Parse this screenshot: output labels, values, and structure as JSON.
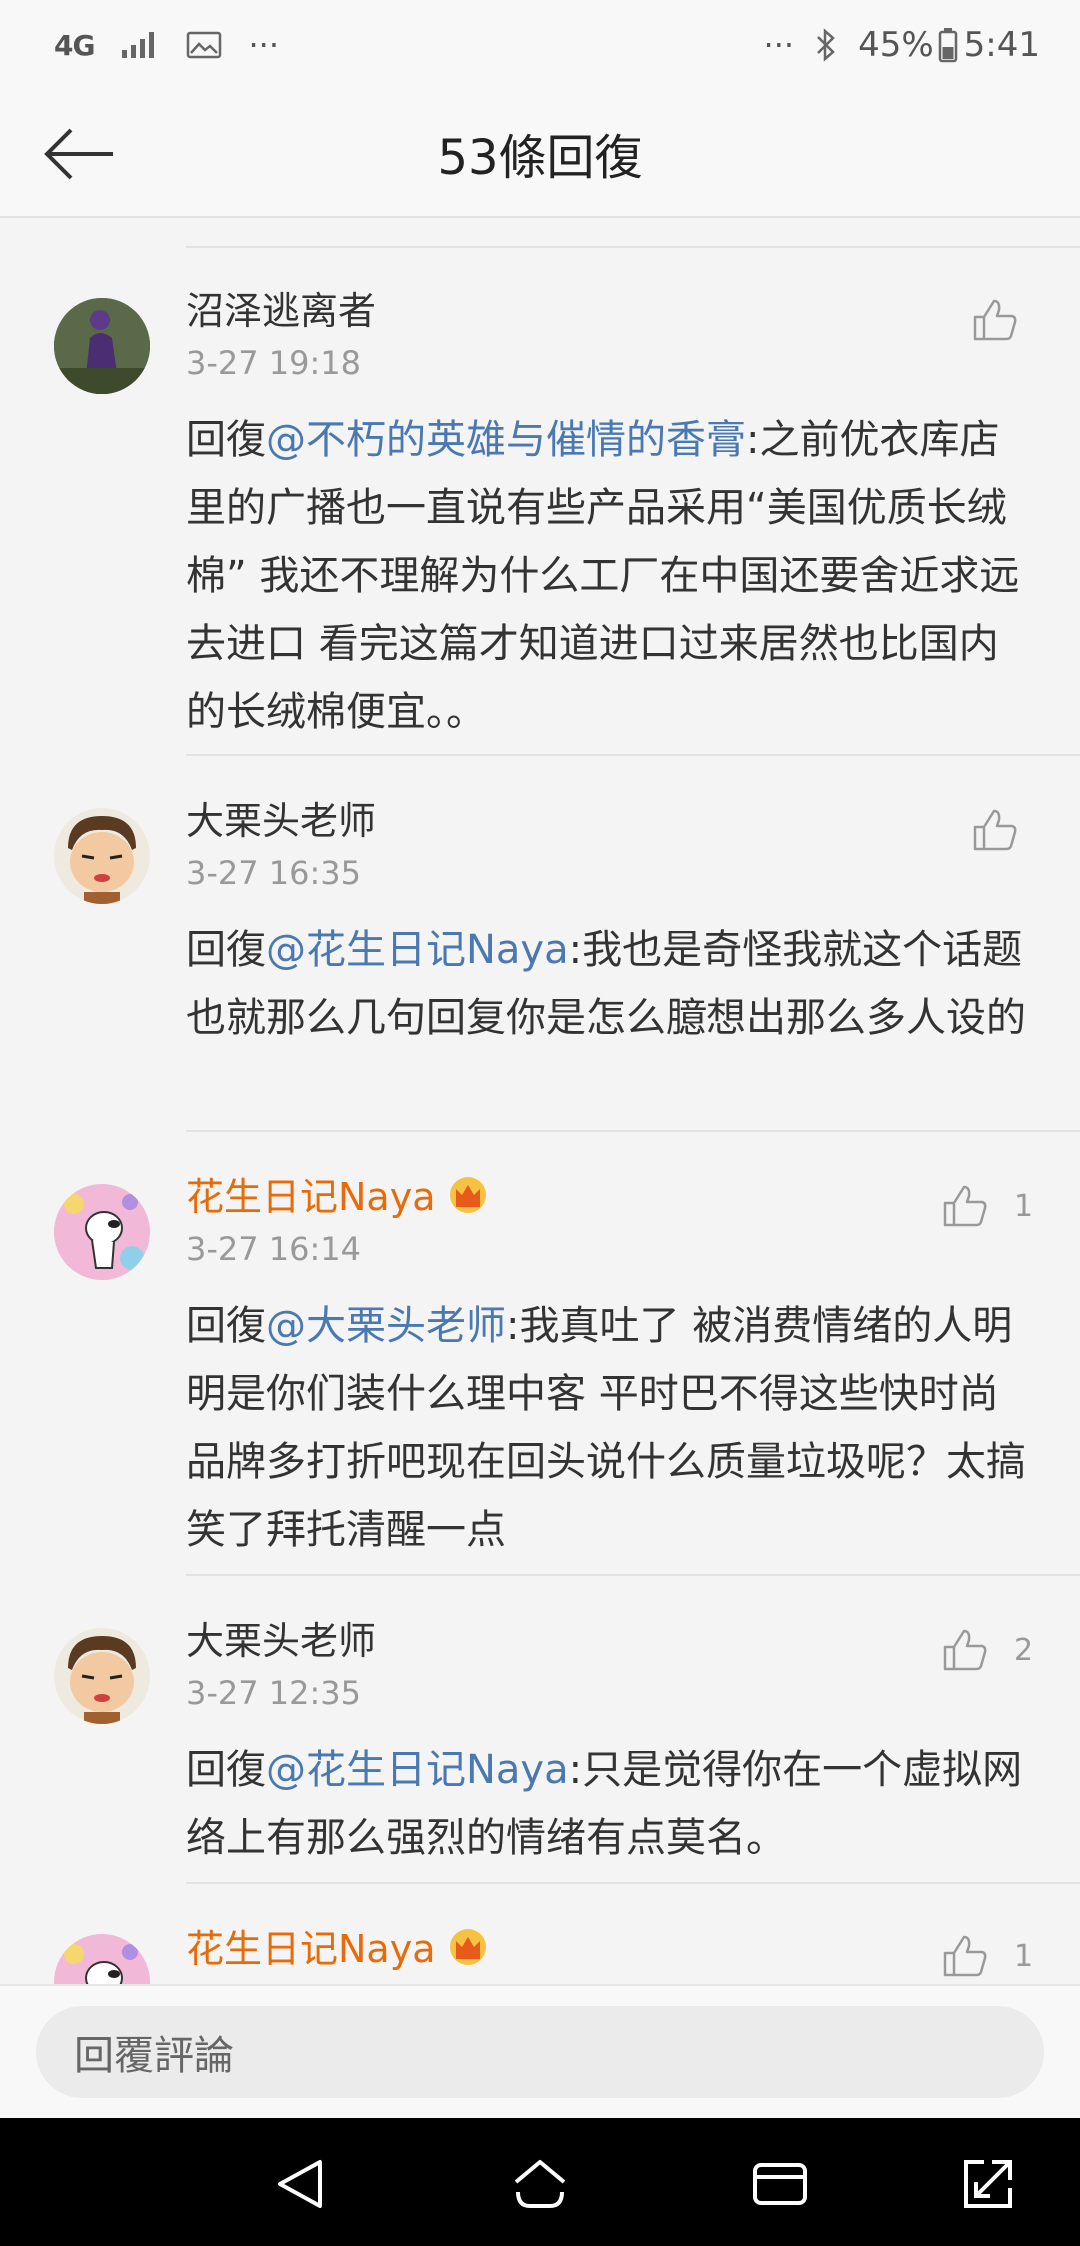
{
  "status_bar": {
    "network": "4G",
    "signal_icon": "signal-icon",
    "gallery_icon": "image-icon",
    "more_left": "···",
    "more_right": "···",
    "bluetooth_icon": "bluetooth-icon",
    "battery_percent": "45%",
    "battery_icon": "battery-icon",
    "time": "5:41"
  },
  "header": {
    "back_icon": "arrow-left-icon",
    "title": "53條回復"
  },
  "comments": [
    {
      "username": "沼泽逃离者",
      "vip": false,
      "time": "3-27 19:18",
      "reply_prefix": "回復",
      "mention": "@不朽的英雄与催情的香膏",
      "body": ":之前优衣库店里的广播也一直说有些产品采用“美国优质长绒棉” 我还不理解为什么工厂在中国还要舍近求远去进口 看完这篇才知道进口过来居然也比国内的长绒棉便宜。。",
      "likes": ""
    },
    {
      "username": "大栗头老师",
      "vip": false,
      "time": "3-27 16:35",
      "reply_prefix": "回復",
      "mention": "@花生日记Naya",
      "body": ":我也是奇怪我就这个话题也就那么几句回复你是怎么臆想出那么多人设的",
      "likes": ""
    },
    {
      "username": "花生日记Naya",
      "vip": true,
      "time": "3-27 16:14",
      "reply_prefix": "回復",
      "mention": "@大栗头老师",
      "body": ":我真吐了 被消费情绪的人明明是你们装什么理中客 平时巴不得这些快时尚品牌多打折吧现在回头说什么质量垃圾呢？太搞笑了拜托清醒一点",
      "likes": "1"
    },
    {
      "username": "大栗头老师",
      "vip": false,
      "time": "3-27 12:35",
      "reply_prefix": "回復",
      "mention": "@花生日记Naya",
      "body": ":只是觉得你在一个虚拟网络上有那么强烈的情绪有点莫名。",
      "likes": "2"
    },
    {
      "username": "花生日记Naya",
      "vip": true,
      "time": "",
      "reply_prefix": "",
      "mention": "",
      "body": "",
      "likes": "1"
    }
  ],
  "reply_box": {
    "placeholder": "回覆評論"
  },
  "nav": {
    "back_icon": "triangle-back-icon",
    "home_icon": "home-icon",
    "recents_icon": "recents-icon",
    "expand_icon": "expand-icon"
  },
  "colors": {
    "accent_mention": "#4a78b0",
    "vip_name": "#e86b0a",
    "background": "#f4f4f4"
  }
}
